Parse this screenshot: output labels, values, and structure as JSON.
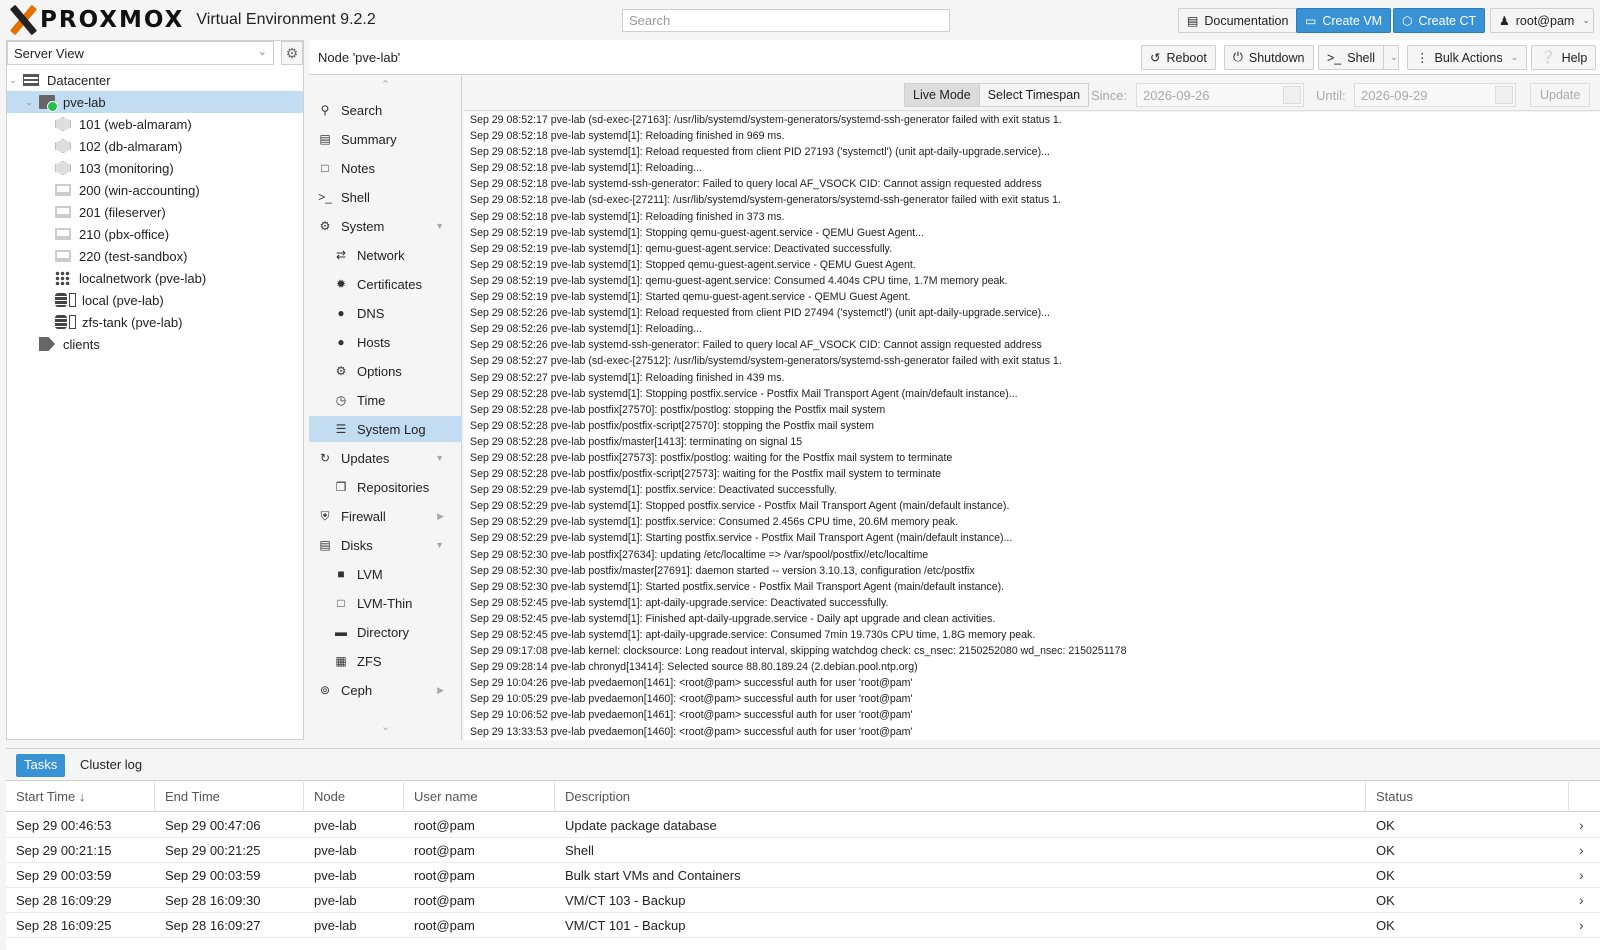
{
  "header": {
    "logo_text": "PROXMOX",
    "version": "Virtual Environment 9.2.2",
    "search_placeholder": "Search",
    "buttons": {
      "documentation": "Documentation",
      "create_vm": "Create VM",
      "create_ct": "Create CT",
      "user": "root@pam"
    }
  },
  "sidebar": {
    "view": "Server View",
    "tree": [
      {
        "label": "Datacenter",
        "icon": "datacenter-icon"
      },
      {
        "label": "pve-lab",
        "icon": "node-online-icon"
      },
      {
        "label": "101 (web-almaram)",
        "icon": "container-icon"
      },
      {
        "label": "102 (db-almaram)",
        "icon": "container-icon"
      },
      {
        "label": "103 (monitoring)",
        "icon": "container-icon"
      },
      {
        "label": "200 (win-accounting)",
        "icon": "vm-icon"
      },
      {
        "label": "201 (fileserver)",
        "icon": "vm-icon"
      },
      {
        "label": "210 (pbx-office)",
        "icon": "vm-icon"
      },
      {
        "label": "220 (test-sandbox)",
        "icon": "vm-icon"
      },
      {
        "label": "localnetwork (pve-lab)",
        "icon": "network-icon"
      },
      {
        "label": "local (pve-lab)",
        "icon": "storage-icon"
      },
      {
        "label": "zfs-tank (pve-lab)",
        "icon": "storage-icon"
      },
      {
        "label": "clients",
        "icon": "tags-icon"
      }
    ]
  },
  "node_header": {
    "title": "Node 'pve-lab'",
    "reboot": "Reboot",
    "shutdown": "Shutdown",
    "shell": "Shell",
    "bulk_actions": "Bulk Actions",
    "help": "Help"
  },
  "nav": {
    "items": [
      {
        "label": "Search",
        "icon": "search-icon"
      },
      {
        "label": "Summary",
        "icon": "book-icon"
      },
      {
        "label": "Notes",
        "icon": "note-icon"
      },
      {
        "label": "Shell",
        "icon": "terminal-icon"
      },
      {
        "label": "System",
        "icon": "cogs-icon"
      },
      {
        "label": "Network",
        "icon": "exchange-icon"
      },
      {
        "label": "Certificates",
        "icon": "certificate-icon"
      },
      {
        "label": "DNS",
        "icon": "globe-icon"
      },
      {
        "label": "Hosts",
        "icon": "globe-icon"
      },
      {
        "label": "Options",
        "icon": "gear-icon"
      },
      {
        "label": "Time",
        "icon": "clock-icon"
      },
      {
        "label": "System Log",
        "icon": "list-icon"
      },
      {
        "label": "Updates",
        "icon": "refresh-icon"
      },
      {
        "label": "Repositories",
        "icon": "files-icon"
      },
      {
        "label": "Firewall",
        "icon": "shield-icon"
      },
      {
        "label": "Disks",
        "icon": "hdd-icon"
      },
      {
        "label": "LVM",
        "icon": "square-icon"
      },
      {
        "label": "LVM-Thin",
        "icon": "square-outline-icon"
      },
      {
        "label": "Directory",
        "icon": "folder-icon"
      },
      {
        "label": "ZFS",
        "icon": "th-large-icon"
      },
      {
        "label": "Ceph",
        "icon": "ceph-icon"
      }
    ]
  },
  "log_toolbar": {
    "live_mode": "Live Mode",
    "select_timespan": "Select Timespan",
    "since_label": "Since:",
    "since_value": "2026-09-26",
    "until_label": "Until:",
    "until_value": "2026-09-29",
    "update": "Update"
  },
  "log_lines": [
    "Sep 29 08:52:17 pve-lab (sd-exec-[27163]: /usr/lib/systemd/system-generators/systemd-ssh-generator failed with exit status 1.",
    "Sep 29 08:52:18 pve-lab systemd[1]: Reloading finished in 969 ms.",
    "Sep 29 08:52:18 pve-lab systemd[1]: Reload requested from client PID 27193 ('systemctl') (unit apt-daily-upgrade.service)...",
    "Sep 29 08:52:18 pve-lab systemd[1]: Reloading...",
    "Sep 29 08:52:18 pve-lab systemd-ssh-generator: Failed to query local AF_VSOCK CID: Cannot assign requested address",
    "Sep 29 08:52:18 pve-lab (sd-exec-[27211]: /usr/lib/systemd/system-generators/systemd-ssh-generator failed with exit status 1.",
    "Sep 29 08:52:18 pve-lab systemd[1]: Reloading finished in 373 ms.",
    "Sep 29 08:52:19 pve-lab systemd[1]: Stopping qemu-guest-agent.service - QEMU Guest Agent...",
    "Sep 29 08:52:19 pve-lab systemd[1]: qemu-guest-agent.service: Deactivated successfully.",
    "Sep 29 08:52:19 pve-lab systemd[1]: Stopped qemu-guest-agent.service - QEMU Guest Agent.",
    "Sep 29 08:52:19 pve-lab systemd[1]: qemu-guest-agent.service: Consumed 4.404s CPU time, 1.7M memory peak.",
    "Sep 29 08:52:19 pve-lab systemd[1]: Started qemu-guest-agent.service - QEMU Guest Agent.",
    "Sep 29 08:52:26 pve-lab systemd[1]: Reload requested from client PID 27494 ('systemctl') (unit apt-daily-upgrade.service)...",
    "Sep 29 08:52:26 pve-lab systemd[1]: Reloading...",
    "Sep 29 08:52:26 pve-lab systemd-ssh-generator: Failed to query local AF_VSOCK CID: Cannot assign requested address",
    "Sep 29 08:52:27 pve-lab (sd-exec-[27512]: /usr/lib/systemd/system-generators/systemd-ssh-generator failed with exit status 1.",
    "Sep 29 08:52:27 pve-lab systemd[1]: Reloading finished in 439 ms.",
    "Sep 29 08:52:28 pve-lab systemd[1]: Stopping postfix.service - Postfix Mail Transport Agent (main/default instance)...",
    "Sep 29 08:52:28 pve-lab postfix[27570]: postfix/postlog: stopping the Postfix mail system",
    "Sep 29 08:52:28 pve-lab postfix/postfix-script[27570]: stopping the Postfix mail system",
    "Sep 29 08:52:28 pve-lab postfix/master[1413]: terminating on signal 15",
    "Sep 29 08:52:28 pve-lab postfix[27573]: postfix/postlog: waiting for the Postfix mail system to terminate",
    "Sep 29 08:52:28 pve-lab postfix/postfix-script[27573]: waiting for the Postfix mail system to terminate",
    "Sep 29 08:52:29 pve-lab systemd[1]: postfix.service: Deactivated successfully.",
    "Sep 29 08:52:29 pve-lab systemd[1]: Stopped postfix.service - Postfix Mail Transport Agent (main/default instance).",
    "Sep 29 08:52:29 pve-lab systemd[1]: postfix.service: Consumed 2.456s CPU time, 20.6M memory peak.",
    "Sep 29 08:52:29 pve-lab systemd[1]: Starting postfix.service - Postfix Mail Transport Agent (main/default instance)...",
    "Sep 29 08:52:30 pve-lab postfix[27634]: updating /etc/localtime => /var/spool/postfix//etc/localtime",
    "Sep 29 08:52:30 pve-lab postfix/master[27691]: daemon started -- version 3.10.13, configuration /etc/postfix",
    "Sep 29 08:52:30 pve-lab systemd[1]: Started postfix.service - Postfix Mail Transport Agent (main/default instance).",
    "Sep 29 08:52:45 pve-lab systemd[1]: apt-daily-upgrade.service: Deactivated successfully.",
    "Sep 29 08:52:45 pve-lab systemd[1]: Finished apt-daily-upgrade.service - Daily apt upgrade and clean activities.",
    "Sep 29 08:52:45 pve-lab systemd[1]: apt-daily-upgrade.service: Consumed 7min 19.730s CPU time, 1.8G memory peak.",
    "Sep 29 09:17:08 pve-lab kernel: clocksource: Long readout interval, skipping watchdog check: cs_nsec: 2150252080 wd_nsec: 2150251178",
    "Sep 29 09:28:14 pve-lab chronyd[13414]: Selected source 88.80.189.24 (2.debian.pool.ntp.org)",
    "Sep 29 10:04:26 pve-lab pvedaemon[1461]: <root@pam> successful auth for user 'root@pam'",
    "Sep 29 10:05:29 pve-lab pvedaemon[1460]: <root@pam> successful auth for user 'root@pam'",
    "Sep 29 10:06:52 pve-lab pvedaemon[1461]: <root@pam> successful auth for user 'root@pam'",
    "Sep 29 13:33:53 pve-lab pvedaemon[1460]: <root@pam> successful auth for user 'root@pam'"
  ],
  "bottom": {
    "tabs": [
      "Tasks",
      "Cluster log"
    ],
    "columns": [
      "Start Time",
      "End Time",
      "Node",
      "User name",
      "Description",
      "Status"
    ],
    "sort_indicator": "↓",
    "rows": [
      [
        "Sep 29 00:46:53",
        "Sep 29 00:47:06",
        "pve-lab",
        "root@pam",
        "Update package database",
        "OK"
      ],
      [
        "Sep 29 00:21:15",
        "Sep 29 00:21:25",
        "pve-lab",
        "root@pam",
        "Shell",
        "OK"
      ],
      [
        "Sep 29 00:03:59",
        "Sep 29 00:03:59",
        "pve-lab",
        "root@pam",
        "Bulk start VMs and Containers",
        "OK"
      ],
      [
        "Sep 28 16:09:29",
        "Sep 28 16:09:30",
        "pve-lab",
        "root@pam",
        "VM/CT 103 - Backup",
        "OK"
      ],
      [
        "Sep 28 16:09:25",
        "Sep 28 16:09:27",
        "pve-lab",
        "root@pam",
        "VM/CT 101 - Backup",
        "OK"
      ]
    ]
  },
  "colors": {
    "accent": "#3892d4",
    "selection": "#c2ddf2",
    "logo_orange": "#e57000",
    "online_green": "#21bf4b"
  }
}
